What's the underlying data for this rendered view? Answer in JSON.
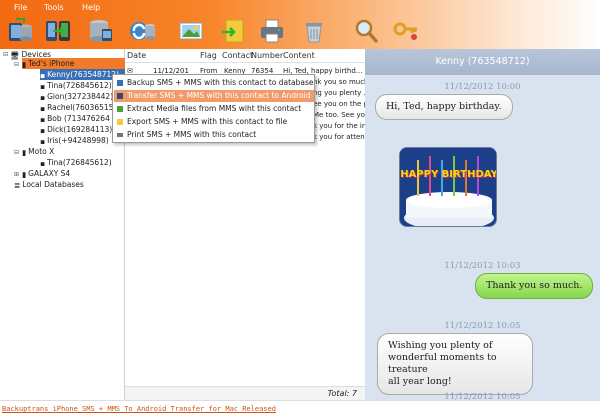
{
  "menu": {
    "file": "File",
    "tools": "Tools",
    "help": "Help"
  },
  "toolbar": {
    "icons": [
      "backup-icon",
      "transfer-icon",
      "database-icon",
      "sync-icon",
      "photo-icon",
      "export-icon",
      "printer-icon",
      "recycle-bin-icon",
      "search-icon",
      "key-icon"
    ]
  },
  "tree": {
    "devices": "Devices",
    "teds_iphone": "Ted's iPhone",
    "contacts": [
      "Kenny(763548712)",
      "Tina(726845612)",
      "Gion(327238442)",
      "Rachel(76036515",
      "Bob (713476264",
      "Dick(169284113)",
      "Iris(+94248998)"
    ],
    "moto_x": "Moto X",
    "moto_contact": "Tina(726845612)",
    "galaxy": "GALAXY S4",
    "local_db": "Local Databases"
  },
  "list": {
    "headers": {
      "date": "Date",
      "flag": "Flag",
      "contact": "Contact",
      "number": "Number",
      "content": "Content"
    },
    "rows": [
      {
        "date": "11/12/201",
        "flag": "From",
        "contact": "Kenny",
        "number": "76354",
        "content": "Hi, Ted, happy birthd..."
      },
      {
        "date": "",
        "flag": "",
        "contact": "",
        "number": "",
        "content": "nk you so much."
      },
      {
        "date": "",
        "flag": "",
        "contact": "",
        "number": "",
        "content": "ng you plenty ..."
      },
      {
        "date": "",
        "flag": "",
        "contact": "",
        "number": "",
        "content": "ee you on the part..."
      },
      {
        "date": "",
        "flag": "",
        "contact": "",
        "number": "",
        "content": "Me too. See you."
      },
      {
        "date": "",
        "flag": "",
        "contact": "",
        "number": "",
        "content": "k you for the invite..."
      },
      {
        "date": "",
        "flag": "",
        "contact": "",
        "number": "",
        "content": "k you for atten..."
      }
    ],
    "total": "Total: 7"
  },
  "context_menu": [
    "Backup SMS + MMS with this contact to database",
    "Transfer SMS + MMS with this contact to Android",
    "Extract Media files from MMS wiht this contact",
    "Export SMS + MMS with this contact to file",
    "Print SMS + MMS with this contact"
  ],
  "conversation": {
    "title": "Kenny (763548712)",
    "messages": [
      {
        "time": "11/12/2012 10:00",
        "dir": "in",
        "text": "Hi, Ted, happy birthday."
      },
      {
        "time": "",
        "dir": "in",
        "media": "HAPPY BIRTHDAY"
      },
      {
        "time": "11/12/2012 10:03",
        "dir": "out",
        "text": "Thank you so much."
      },
      {
        "time": "11/12/2012 10:05",
        "dir": "in",
        "lines": [
          "Wishing you plenty of",
          "wonderful moments to treature",
          "all year long!"
        ]
      },
      {
        "time": "11/12/2012 10:05",
        "dir": "",
        "text": ""
      }
    ]
  },
  "status": {
    "link": "Backuptrans iPhone SMS + MMS To Android Transfer for Mac Released"
  },
  "colors": {
    "accent": "#f26a12",
    "selected": "#3a6fb5",
    "highlight": "#f29b6a",
    "bubble_out": "#86d64e",
    "panel": "#d9e3f0"
  }
}
